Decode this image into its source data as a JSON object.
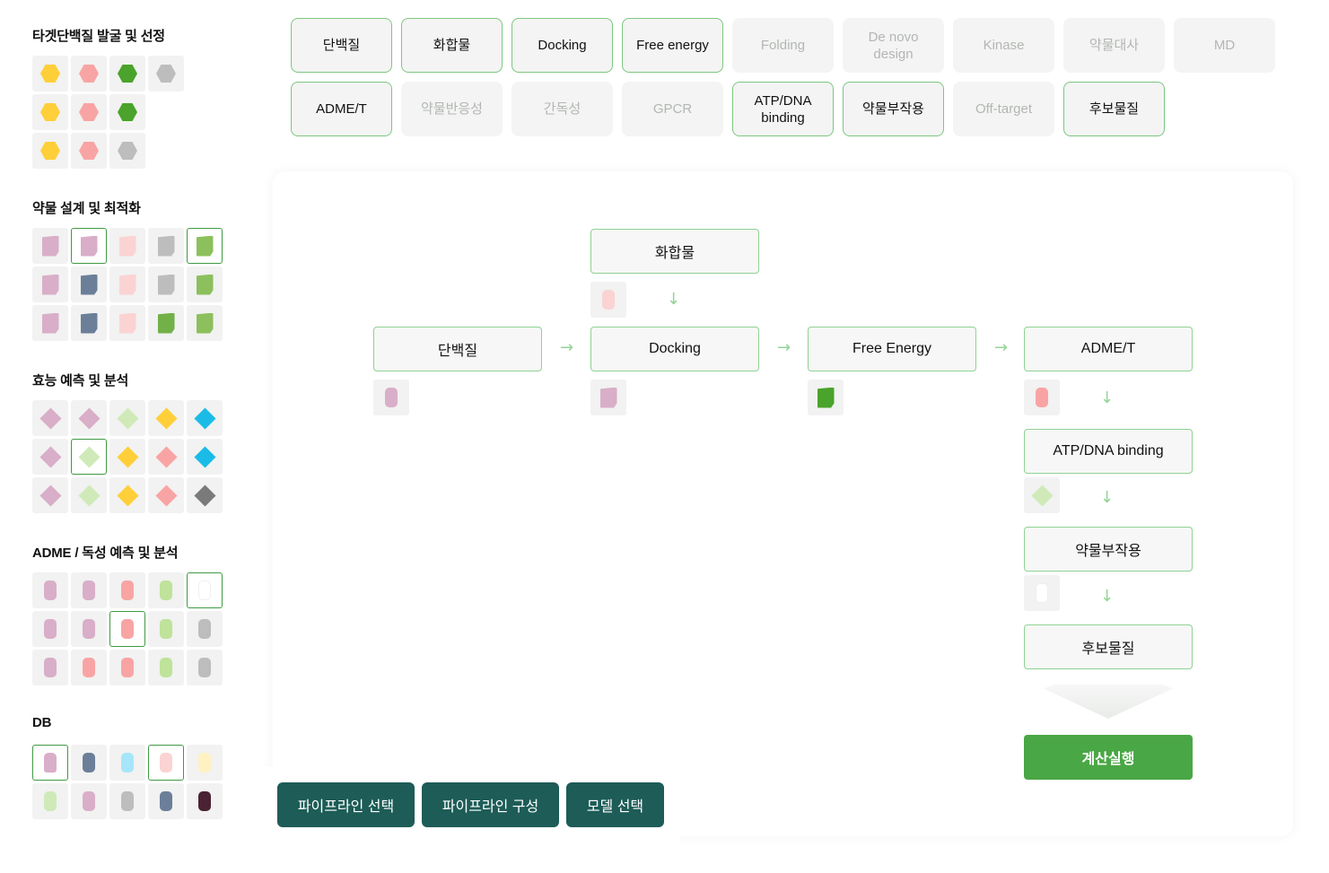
{
  "palette": {
    "sections": [
      {
        "title": "타겟단백질 발굴 및 선정"
      },
      {
        "title": "약물 설계 및 최적화"
      },
      {
        "title": "효능 예측 및 분석"
      },
      {
        "title": "ADME / 독성 예측 및 분석"
      },
      {
        "title": "DB"
      }
    ]
  },
  "tags": [
    {
      "label": "단백질",
      "active": true
    },
    {
      "label": "화합물",
      "active": true
    },
    {
      "label": "Docking",
      "active": true
    },
    {
      "label": "Free energy",
      "active": true
    },
    {
      "label": "Folding",
      "active": false
    },
    {
      "label": "De novo design",
      "active": false
    },
    {
      "label": "Kinase",
      "active": false
    },
    {
      "label": "약물대사",
      "active": false
    },
    {
      "label": "MD",
      "active": false
    },
    {
      "label": "ADME/T",
      "active": true
    },
    {
      "label": "약물반응성",
      "active": false
    },
    {
      "label": "간독성",
      "active": false
    },
    {
      "label": "GPCR",
      "active": false
    },
    {
      "label": "ATP/DNA binding",
      "active": true
    },
    {
      "label": "약물부작용",
      "active": true
    },
    {
      "label": "Off-target",
      "active": false
    },
    {
      "label": "후보물질",
      "active": true
    }
  ],
  "pipeline": {
    "nodes": {
      "compound": "화합물",
      "protein": "단백질",
      "docking": "Docking",
      "free_energy": "Free Energy",
      "admet": "ADME/T",
      "atp_dna": "ATP/DNA binding",
      "side_effect": "약물부작용",
      "candidate": "후보물질"
    },
    "run_label": "계산실행"
  },
  "bottom_buttons": {
    "select_pipeline": "파이프라인 선택",
    "build_pipeline": "파이프라인 구성",
    "select_model": "모델 선택"
  },
  "colors": {
    "accent_green": "#4aa745",
    "dark_teal": "#1d5c57",
    "border_green": "#8fd293"
  }
}
